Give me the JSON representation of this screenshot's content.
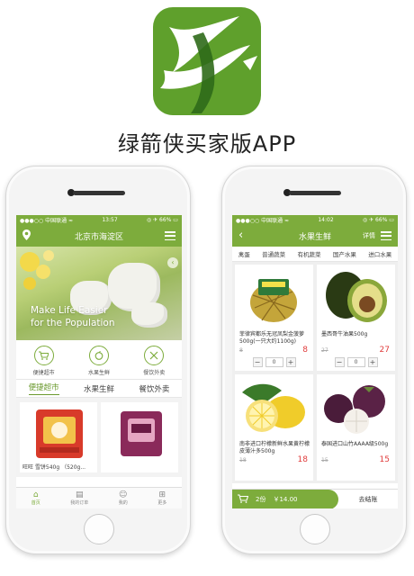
{
  "app": {
    "title": "绿箭侠买家版APP"
  },
  "left_screen": {
    "status": {
      "carrier": "●●●○○ 中国联通 ≈",
      "time": "13:57",
      "battery": "◎ ✈ 66% ▭"
    },
    "nav": {
      "title": "北京市海淀区"
    },
    "banner": {
      "line1": "Make Life Easier",
      "line2": "for the Population"
    },
    "categories": [
      {
        "label": "便捷超市",
        "icon": "cart-icon"
      },
      {
        "label": "水果生鲜",
        "icon": "fruit-icon"
      },
      {
        "label": "餐饮外卖",
        "icon": "cutlery-icon"
      }
    ],
    "tabs": [
      "便捷超市",
      "水果生鲜",
      "餐饮外卖"
    ],
    "products": [
      {
        "label": "旺旺 雪饼540g （520g..."
      },
      {
        "label": ""
      }
    ],
    "bottom_nav": [
      "首页",
      "我的订单",
      "我的",
      "更多"
    ]
  },
  "right_screen": {
    "status": {
      "carrier": "●●●○○ 中国联通 ≈",
      "time": "14:02",
      "battery": "◎ ✈ 66% ▭"
    },
    "nav": {
      "title": "水果生鲜",
      "detail": "详情"
    },
    "subtabs": [
      "禽蛋",
      "普通蔬菜",
      "有机蔬菜",
      "国产水果",
      "进口水果"
    ],
    "items": [
      {
        "name": "菲律宾都乐无冠凤梨金菠萝500g(一只大约1100g)",
        "old": "8",
        "price": "8",
        "qty": "0",
        "colors": [
          "#c4a53a",
          "#2f7a3a"
        ]
      },
      {
        "name": "墨西哥牛油果500g",
        "old": "27",
        "price": "27",
        "qty": "0",
        "colors": [
          "#3a4a1e",
          "#d6c25a"
        ]
      },
      {
        "name": "南非进口柠檬新鲜水果黄柠檬 皮薄汁多500g",
        "old": "18",
        "price": "18",
        "qty": "",
        "colors": [
          "#f3d940",
          "#3b7a2a"
        ]
      },
      {
        "name": "泰国进口山竹AAAA级500g",
        "old": "15",
        "price": "15",
        "qty": "",
        "colors": [
          "#4a1c3a",
          "#6b8a3a"
        ]
      }
    ],
    "cart": {
      "count": "2份",
      "total": "￥14.00",
      "checkout": "去结账"
    }
  }
}
